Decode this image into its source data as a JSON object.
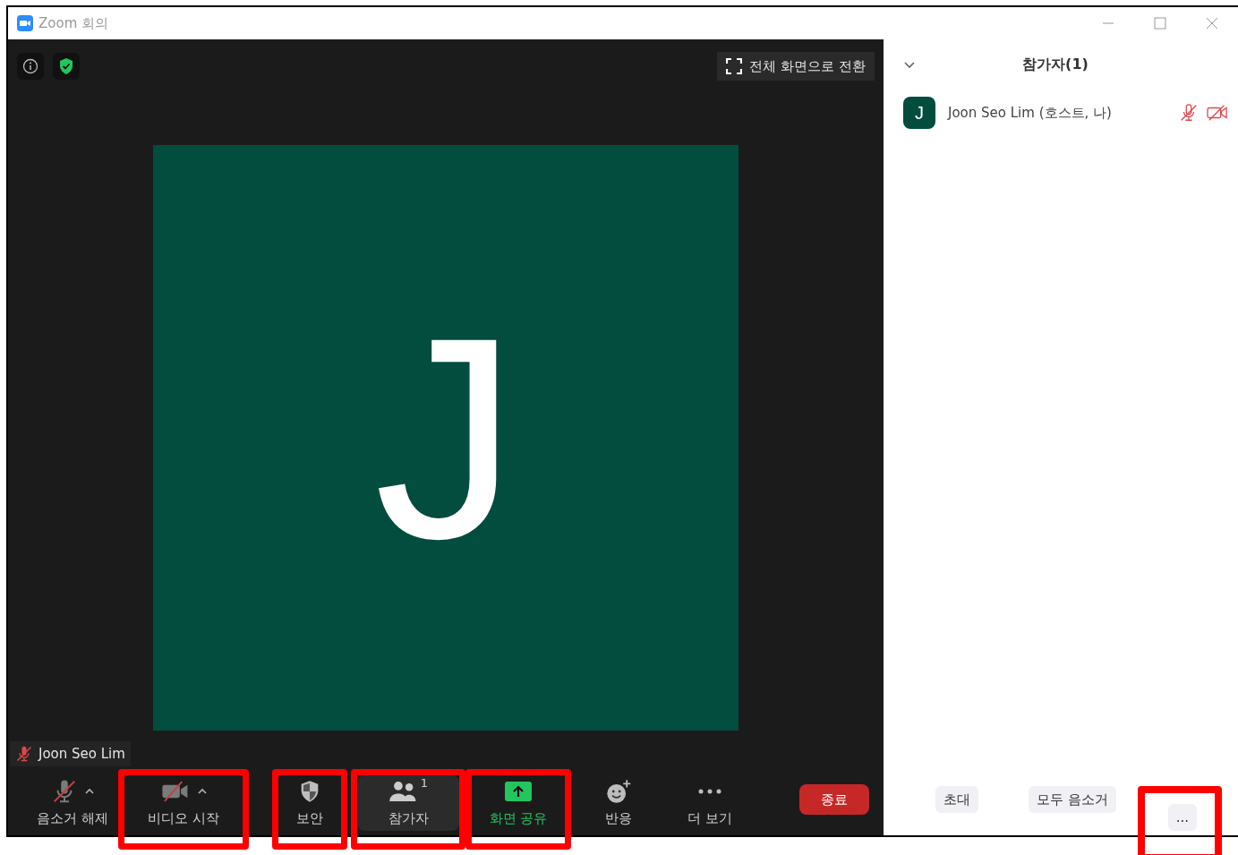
{
  "window": {
    "title": "Zoom 회의"
  },
  "video": {
    "fullscreen_button": "전체 화면으로 전환",
    "tile_initial": "J",
    "name_tag": {
      "name": "Joon Seo Lim",
      "muted": true
    }
  },
  "toolbar": {
    "items": [
      {
        "kind": "mic",
        "label": "음소거 해제",
        "off": true,
        "caret": true,
        "selected": false,
        "highlighted": false
      },
      {
        "kind": "video",
        "label": "비디오 시작",
        "off": true,
        "caret": true,
        "selected": false,
        "highlighted": true
      },
      {
        "kind": "security",
        "label": "보안",
        "off": false,
        "caret": false,
        "selected": false,
        "highlighted": true
      },
      {
        "kind": "participants",
        "label": "참가자",
        "count": "1",
        "off": false,
        "caret": false,
        "selected": true,
        "highlighted": true
      },
      {
        "kind": "share",
        "label": "화면 공유",
        "off": false,
        "caret": false,
        "selected": false,
        "highlighted": true
      },
      {
        "kind": "reactions",
        "label": "반응",
        "off": false,
        "caret": false,
        "selected": false,
        "highlighted": false
      },
      {
        "kind": "more",
        "label": "더 보기",
        "off": false,
        "caret": false,
        "selected": false,
        "highlighted": false
      }
    ],
    "end_button": "종료"
  },
  "participants_panel": {
    "title": "참가자(1)",
    "participants": [
      {
        "initial": "J",
        "name": "Joon Seo Lim (호스트, 나)",
        "mic_muted": true,
        "video_off": true
      }
    ],
    "buttons": [
      {
        "label": "초대",
        "highlighted": false
      },
      {
        "label": "모두 음소거",
        "highlighted": false
      },
      {
        "label": "...",
        "highlighted": true
      }
    ]
  }
}
